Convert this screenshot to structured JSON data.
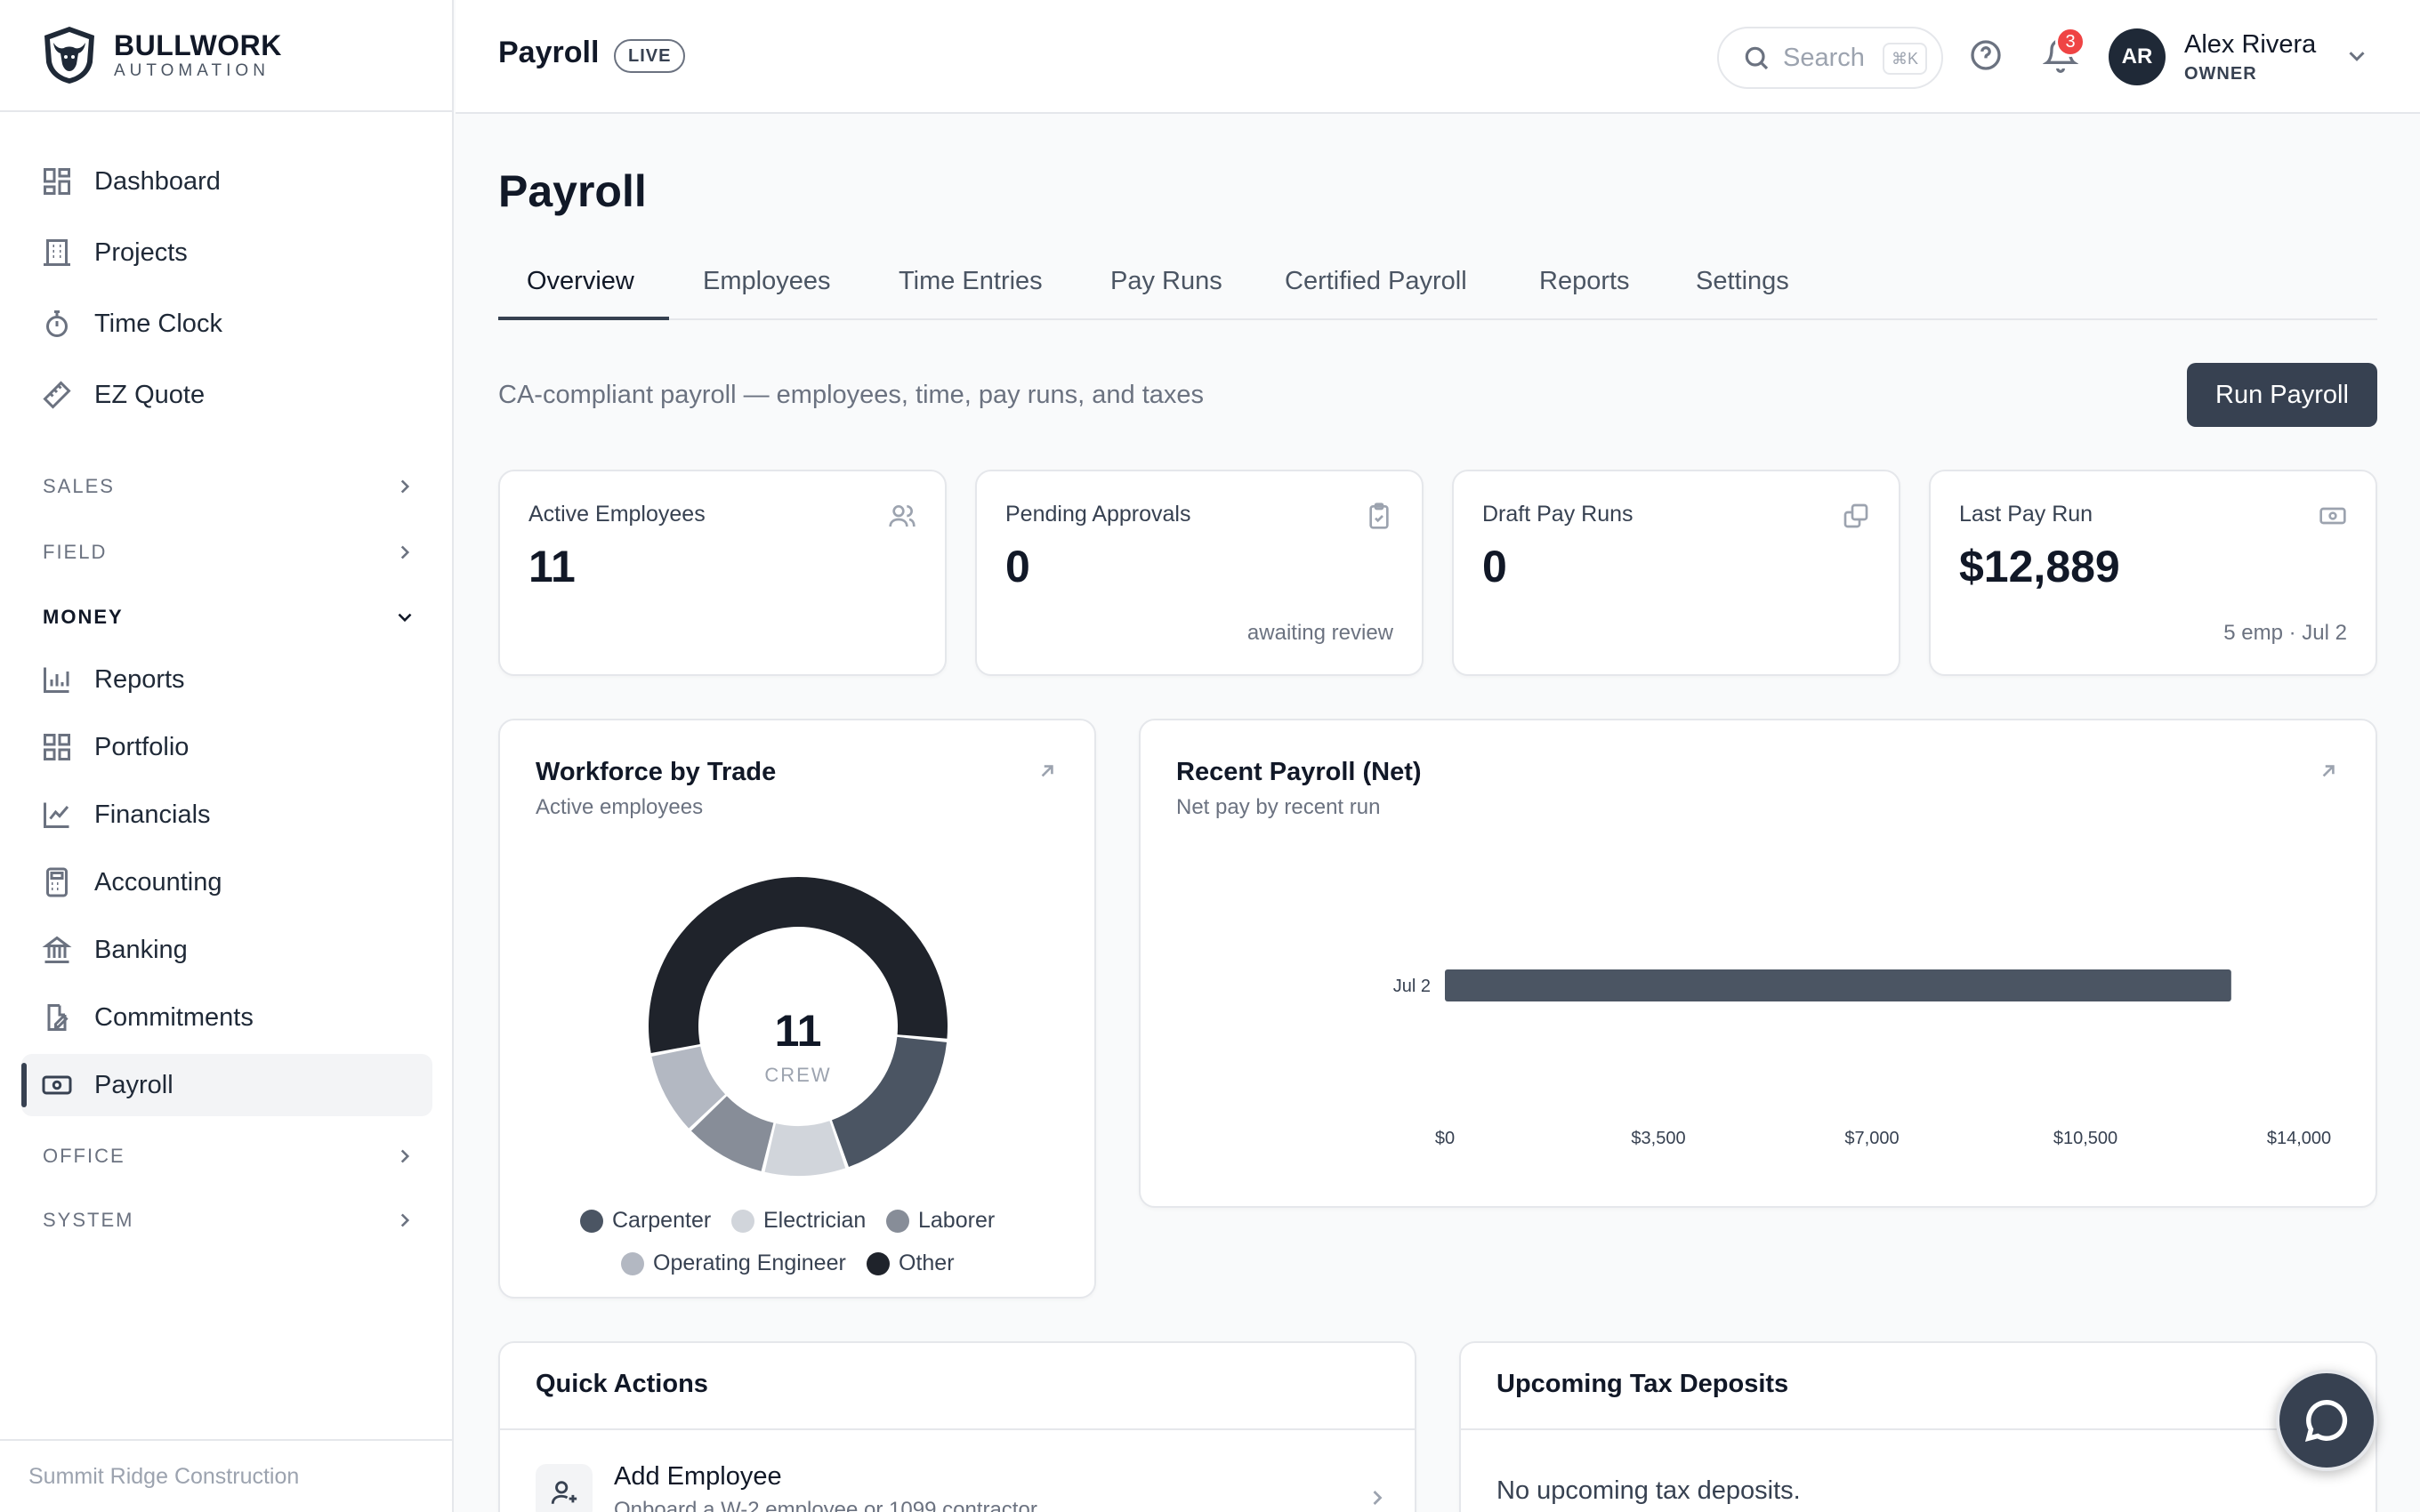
{
  "brand": {
    "name": "BULLWORK",
    "sub": "AUTOMATION"
  },
  "sidebar": {
    "items": [
      {
        "label": "Dashboard",
        "icon": "dashboard-icon"
      },
      {
        "label": "Projects",
        "icon": "building-icon"
      },
      {
        "label": "Time Clock",
        "icon": "stopwatch-icon"
      },
      {
        "label": "EZ Quote",
        "icon": "ruler-icon"
      }
    ],
    "sections": {
      "sales": "SALES",
      "field": "FIELD",
      "money": "MONEY",
      "office": "OFFICE",
      "system": "SYSTEM"
    },
    "money_items": [
      {
        "label": "Reports",
        "icon": "bar-chart-icon"
      },
      {
        "label": "Portfolio",
        "icon": "grid-icon"
      },
      {
        "label": "Financials",
        "icon": "line-chart-icon"
      },
      {
        "label": "Accounting",
        "icon": "calculator-icon"
      },
      {
        "label": "Banking",
        "icon": "bank-icon"
      },
      {
        "label": "Commitments",
        "icon": "document-edit-icon"
      },
      {
        "label": "Payroll",
        "icon": "banknote-icon",
        "active": true
      }
    ],
    "footer": "Summit Ridge Construction"
  },
  "header": {
    "title": "Payroll",
    "badge": "LIVE",
    "search_placeholder": "Search",
    "search_shortcut": "⌘K",
    "notification_count": "3",
    "user": {
      "initials": "AR",
      "name": "Alex Rivera",
      "role": "OWNER"
    }
  },
  "main": {
    "title": "Payroll",
    "tabs": [
      "Overview",
      "Employees",
      "Time Entries",
      "Pay Runs",
      "Certified Payroll",
      "Reports",
      "Settings"
    ],
    "active_tab": "Overview",
    "subtitle": "CA-compliant payroll — employees, time, pay runs, and taxes",
    "primary_action": "Run Payroll",
    "stats": [
      {
        "label": "Active Employees",
        "value": "11",
        "note": "",
        "icon": "users-icon"
      },
      {
        "label": "Pending Approvals",
        "value": "0",
        "note": "awaiting review",
        "icon": "clipboard-check-icon"
      },
      {
        "label": "Draft Pay Runs",
        "value": "0",
        "note": "",
        "icon": "copy-icon"
      },
      {
        "label": "Last Pay Run",
        "value": "$12,889",
        "note": "5 emp · Jul 2",
        "icon": "banknote-icon"
      }
    ],
    "workforce": {
      "title": "Workforce by Trade",
      "subtitle": "Active employees",
      "center_value": "11",
      "center_label": "CREW"
    },
    "recent_payroll": {
      "title": "Recent Payroll (Net)",
      "subtitle": "Net pay by recent run"
    },
    "quick_actions": {
      "title": "Quick Actions",
      "items": [
        {
          "title": "Add Employee",
          "description": "Onboard a W-2 employee or 1099 contractor"
        }
      ]
    },
    "tax_deposits": {
      "title": "Upcoming Tax Deposits",
      "empty": "No upcoming tax deposits."
    }
  },
  "colors": {
    "accent": "#374151",
    "carpenter": "#4b5563",
    "electrician": "#d1d5db",
    "laborer": "#878d98",
    "operating_engineer": "#b3b8c2",
    "other": "#1f232b",
    "notification": "#ef4444"
  },
  "chart_data": [
    {
      "type": "pie",
      "title": "Workforce by Trade",
      "subtitle": "Active employees",
      "categories": [
        "Carpenter",
        "Electrician",
        "Laborer",
        "Operating Engineer",
        "Other"
      ],
      "values": [
        2,
        1,
        1,
        1,
        6
      ],
      "colors": [
        "#4b5563",
        "#d1d5db",
        "#878d98",
        "#b3b8c2",
        "#1f232b"
      ],
      "total": 11,
      "legend": "bottom"
    },
    {
      "type": "bar",
      "orientation": "horizontal",
      "title": "Recent Payroll (Net)",
      "subtitle": "Net pay by recent run",
      "categories": [
        "Jul 2"
      ],
      "values": [
        12889
      ],
      "xlim": [
        0,
        14000
      ],
      "xticks": [
        "$0",
        "$3,500",
        "$7,000",
        "$10,500",
        "$14,000"
      ],
      "grid": false
    }
  ]
}
